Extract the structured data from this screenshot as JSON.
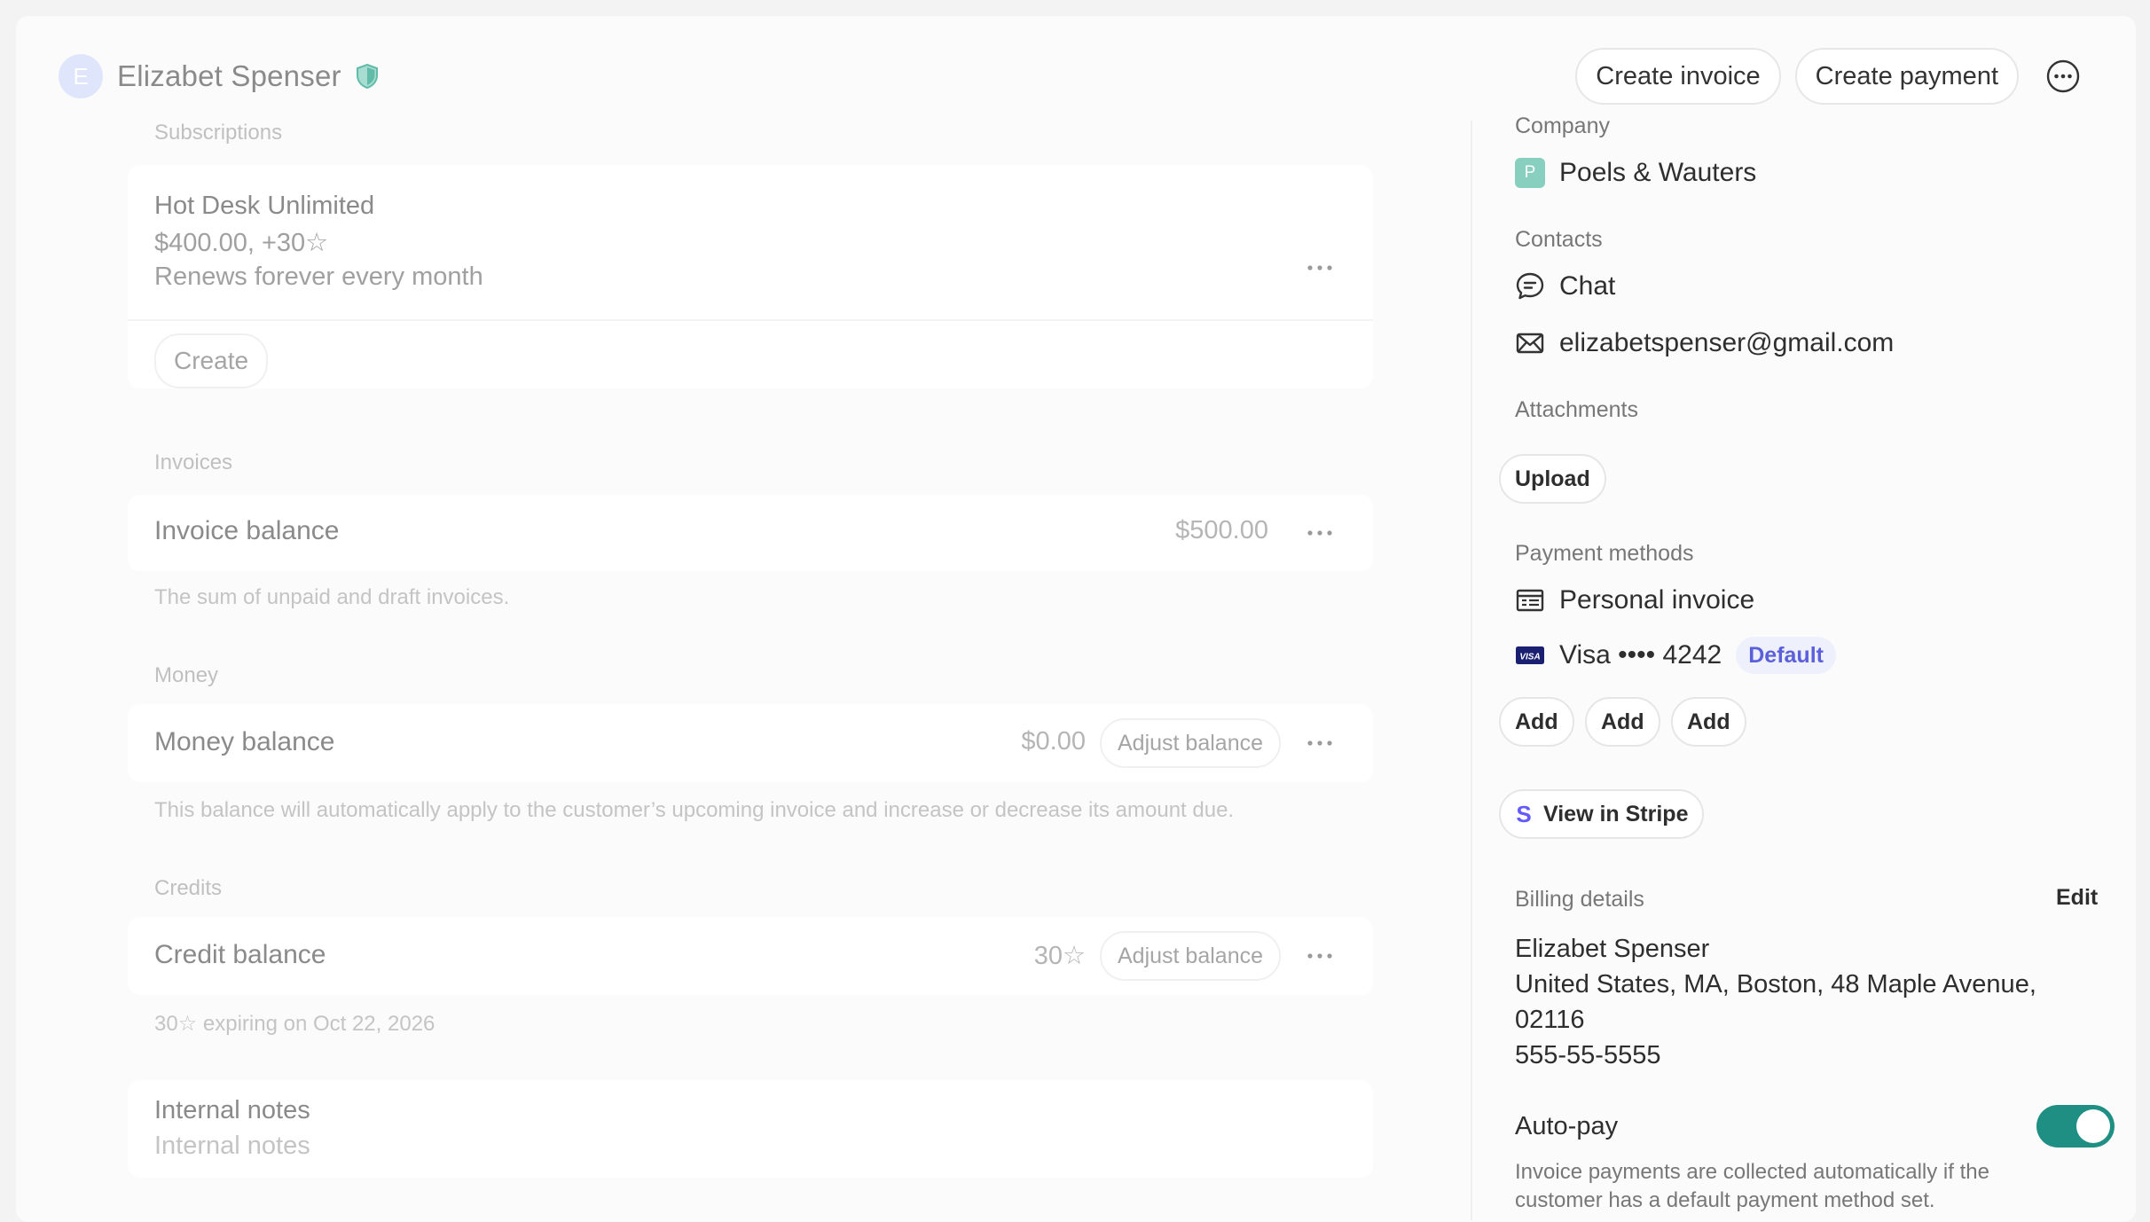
{
  "customer": {
    "initial": "E",
    "name": "Elizabet Spenser"
  },
  "header": {
    "create_invoice": "Create invoice",
    "create_payment": "Create payment"
  },
  "subscriptions": {
    "label": "Subscriptions",
    "item_name": "Hot Desk Unlimited",
    "item_price": "$400.00, +30☆",
    "item_renewal": "Renews forever every month",
    "create_label": "Create"
  },
  "invoices": {
    "label": "Invoices",
    "row_title": "Invoice balance",
    "amount": "$500.00",
    "note": "The sum of unpaid and draft invoices."
  },
  "money": {
    "label": "Money",
    "row_title": "Money balance",
    "amount": "$0.00",
    "adjust_label": "Adjust balance",
    "note": "This balance will automatically apply to the customer’s upcoming invoice and increase or decrease its amount due."
  },
  "credits": {
    "label": "Credits",
    "row_title": "Credit balance",
    "amount": "30☆",
    "adjust_label": "Adjust balance",
    "note": "30☆ expiring on Oct 22, 2026"
  },
  "internal_notes": {
    "title": "Internal notes",
    "placeholder": "Internal notes"
  },
  "sidebar": {
    "company_label": "Company",
    "company_initial": "P",
    "company_name": "Poels & Wauters",
    "contacts_label": "Contacts",
    "chat_label": "Chat",
    "email": "elizabetspenser@gmail.com",
    "attachments_label": "Attachments",
    "upload_label": "Upload",
    "payment_methods_label": "Payment methods",
    "personal_invoice": "Personal invoice",
    "card_label": "Visa •••• 4242",
    "card_badge": "Default",
    "add_buttons": [
      "Add",
      "Add",
      "Add"
    ],
    "stripe_label": "View in Stripe",
    "billing_label": "Billing details",
    "billing_edit": "Edit",
    "billing_name": "Elizabet Spenser",
    "billing_address_line1": "United States, MA, Boston, 48 Maple Avenue,",
    "billing_address_line2": "02116",
    "billing_phone": "555-55-5555",
    "autopay_label": "Auto-pay",
    "autopay_on": true,
    "autopay_note_line1": "Invoice payments are collected automatically if the",
    "autopay_note_line2": "customer has a default payment method set."
  },
  "colors": {
    "accent_teal": "#1f8f84",
    "badge_purple": "#5b5fd9",
    "stripe_purple": "#635bff"
  }
}
